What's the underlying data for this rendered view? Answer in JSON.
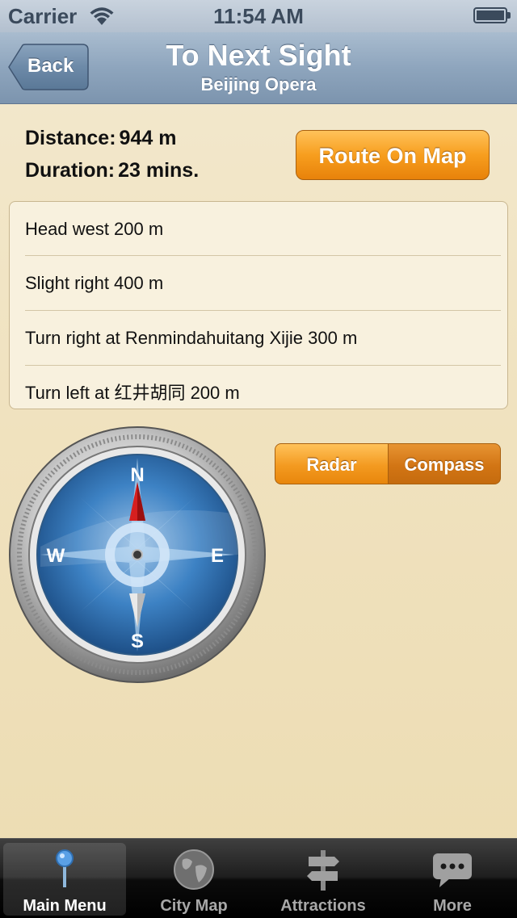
{
  "status_bar": {
    "carrier": "Carrier",
    "time": "11:54 AM"
  },
  "nav": {
    "back_label": "Back",
    "title": "To Next Sight",
    "subtitle": "Beijing Opera"
  },
  "info": {
    "distance_label": "Distance:",
    "distance_value": "944 m",
    "duration_label": "Duration:",
    "duration_value": "23 mins."
  },
  "route_button": "Route On Map",
  "directions": [
    "Head west 200 m",
    "Slight right 400 m",
    "Turn right at Renmindahuitang Xijie 300 m",
    "Turn left at 红井胡同 200 m"
  ],
  "mode_toggle": {
    "radar": "Radar",
    "compass": "Compass",
    "selected": "compass"
  },
  "compass": {
    "north": "N",
    "south": "S",
    "east": "E",
    "west": "W"
  },
  "tabs": [
    {
      "label": "Main Menu",
      "icon": "map-pin-icon",
      "active": true
    },
    {
      "label": "City Map",
      "icon": "globe-icon",
      "active": false
    },
    {
      "label": "Attractions",
      "icon": "signpost-icon",
      "active": false
    },
    {
      "label": "More",
      "icon": "speech-bubble-icon",
      "active": false
    }
  ],
  "colors": {
    "accent": "#f39a20",
    "nav": "#8ea5bd",
    "background": "#f0e2bf"
  }
}
